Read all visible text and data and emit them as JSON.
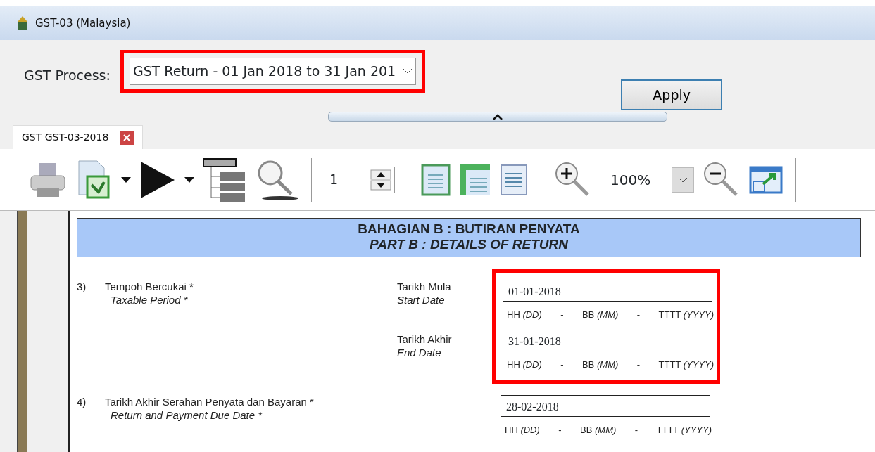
{
  "window": {
    "title": "GST-03 (Malaysia)"
  },
  "process": {
    "label": "GST Process:",
    "value": "GST Return - 01 Jan 2018 to 31 Jan 201",
    "highlighted": true
  },
  "apply_button": {
    "label": "Apply"
  },
  "tabs": [
    {
      "label": "GST GST-03-2018",
      "selected": true
    }
  ],
  "toolbar": {
    "page": "1",
    "zoom": "100%"
  },
  "report": {
    "header": {
      "title": "BAHAGIAN B : BUTIRAN PENYATA",
      "subtitle": "PART B : DETAILS OF RETURN"
    },
    "items": [
      {
        "number": "3)",
        "label": "Tempoh Bercukai *",
        "label_en": "Taxable Period *",
        "highlighted": true,
        "dates": [
          {
            "label": "Tarikh Mula",
            "label_en": "Start Date",
            "value": "01-01-2018",
            "hint": [
              "HH *(DD)*",
              "-",
              "BB *(MM)*",
              "-",
              "TTTT *(YYYY)*"
            ]
          },
          {
            "label": "Tarikh Akhir",
            "label_en": "End Date",
            "value": "31-01-2018",
            "hint": [
              "HH *(DD)*",
              "-",
              "BB *(MM)*",
              "-",
              "TTTT *(YYYY)*"
            ]
          }
        ]
      },
      {
        "number": "4)",
        "label": "Tarikh Akhir Serahan Penyata dan Bayaran *",
        "label_en": "Return and Payment Due Date *",
        "highlighted": false,
        "dates": [
          {
            "value": "28-02-2018",
            "hint": [
              "HH *(DD)*",
              "-",
              "BB *(MM)*",
              "-",
              "TTTT *(YYYY)*"
            ]
          }
        ]
      }
    ]
  }
}
